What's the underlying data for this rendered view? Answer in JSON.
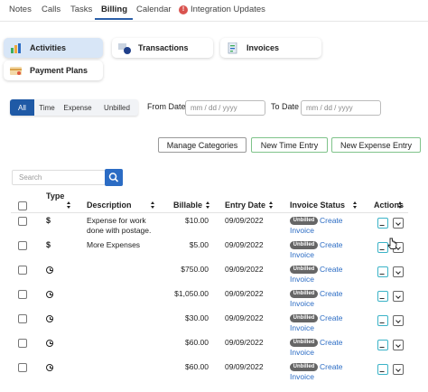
{
  "tabs": [
    {
      "label": "Notes",
      "active": false
    },
    {
      "label": "Calls",
      "active": false
    },
    {
      "label": "Tasks",
      "active": false
    },
    {
      "label": "Billing",
      "active": true
    },
    {
      "label": "Calendar",
      "active": false
    },
    {
      "label": "Integration Updates",
      "active": false,
      "badge": "!"
    }
  ],
  "modules": [
    {
      "label": "Activities",
      "active": true,
      "icon": "activities-icon"
    },
    {
      "label": "Transactions",
      "active": false,
      "icon": "transactions-icon"
    },
    {
      "label": "Invoices",
      "active": false,
      "icon": "invoices-icon"
    },
    {
      "label": "Payment Plans",
      "active": false,
      "icon": "payment-plans-icon"
    }
  ],
  "filters": {
    "segments": [
      "All",
      "Time",
      "Expense",
      "Unbilled"
    ],
    "selected": "All",
    "from_label": "From Date",
    "to_label": "To Date",
    "date_placeholder": "mm / dd / yyyy"
  },
  "actions": {
    "manage": "Manage Categories",
    "new_time": "New Time Entry",
    "new_expense": "New Expense Entry"
  },
  "search": {
    "placeholder": "Search"
  },
  "table": {
    "headers": {
      "type": "Type",
      "description": "Description",
      "billable": "Billable",
      "entry_date": "Entry Date",
      "invoice_status": "Invoice Status",
      "actions": "Actions"
    },
    "rows": [
      {
        "type": "expense",
        "type_glyph": "$",
        "description": "Expense for work done with postage.",
        "billable": "$10.00",
        "entry_date": "09/09/2022",
        "status": "Unbilled",
        "link": "Create Invoice"
      },
      {
        "type": "expense",
        "type_glyph": "$",
        "description": "More Expenses",
        "billable": "$5.00",
        "entry_date": "09/09/2022",
        "status": "Unbilled",
        "link": "Create Invoice"
      },
      {
        "type": "time",
        "type_glyph": "",
        "description": "",
        "billable": "$750.00",
        "entry_date": "09/09/2022",
        "status": "Unbilled",
        "link": "Create Invoice"
      },
      {
        "type": "time",
        "type_glyph": "",
        "description": "",
        "billable": "$1,050.00",
        "entry_date": "09/09/2022",
        "status": "Unbilled",
        "link": "Create Invoice"
      },
      {
        "type": "time",
        "type_glyph": "",
        "description": "",
        "billable": "$30.00",
        "entry_date": "09/09/2022",
        "status": "Unbilled",
        "link": "Create Invoice"
      },
      {
        "type": "time",
        "type_glyph": "",
        "description": "",
        "billable": "$60.00",
        "entry_date": "09/09/2022",
        "status": "Unbilled",
        "link": "Create Invoice"
      },
      {
        "type": "time",
        "type_glyph": "",
        "description": "",
        "billable": "$60.00",
        "entry_date": "09/09/2022",
        "status": "Unbilled",
        "link": "Create Invoice"
      }
    ]
  },
  "colors": {
    "accent": "#1f5aa6",
    "link": "#2b6cc4",
    "green_border": "#7fc38a",
    "badge_red": "#d9534f"
  }
}
